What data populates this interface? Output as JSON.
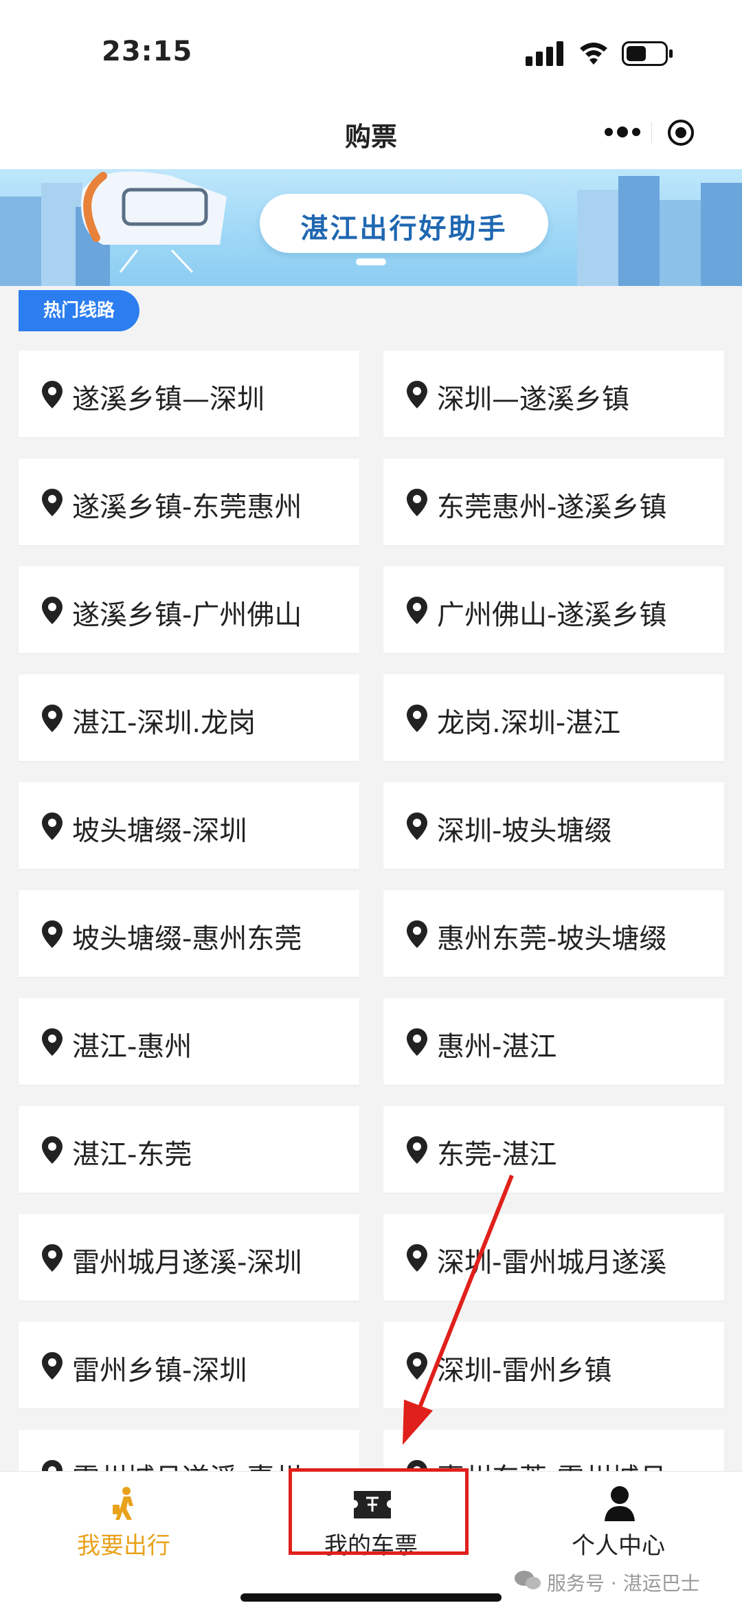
{
  "status_bar": {
    "time": "23:15"
  },
  "nav": {
    "title": "购票"
  },
  "banner": {
    "text": "湛江出行好助手"
  },
  "section": {
    "title": "热门线路"
  },
  "routes": [
    "遂溪乡镇—深圳",
    "深圳—遂溪乡镇",
    "遂溪乡镇-东莞惠州",
    "东莞惠州-遂溪乡镇",
    "遂溪乡镇-广州佛山",
    "广州佛山-遂溪乡镇",
    "湛江-深圳.龙岗",
    "龙岗.深圳-湛江",
    "坡头塘缀-深圳",
    "深圳-坡头塘缀",
    "坡头塘缀-惠州东莞",
    "惠州东莞-坡头塘缀",
    "湛江-惠州",
    "惠州-湛江",
    "湛江-东莞",
    "东莞-湛江",
    "雷州城月遂溪-深圳",
    "深圳-雷州城月遂溪",
    "雷州乡镇-深圳",
    "深圳-雷州乡镇",
    "雷州城月遂溪-惠州",
    "惠州东莞-雷州城月"
  ],
  "tabs": {
    "go": {
      "label": "我要出行",
      "icon": "walking-person-icon",
      "color": "#e8a21c"
    },
    "tickets": {
      "label": "我的车票",
      "icon": "ticket-icon"
    },
    "profile": {
      "label": "个人中心",
      "icon": "person-icon"
    }
  },
  "watermark": {
    "text": "服务号 · 湛运巴士"
  },
  "colors": {
    "accent": "#2c7df0",
    "highlight": "#e0201b",
    "active_tab": "#e8a21c"
  }
}
